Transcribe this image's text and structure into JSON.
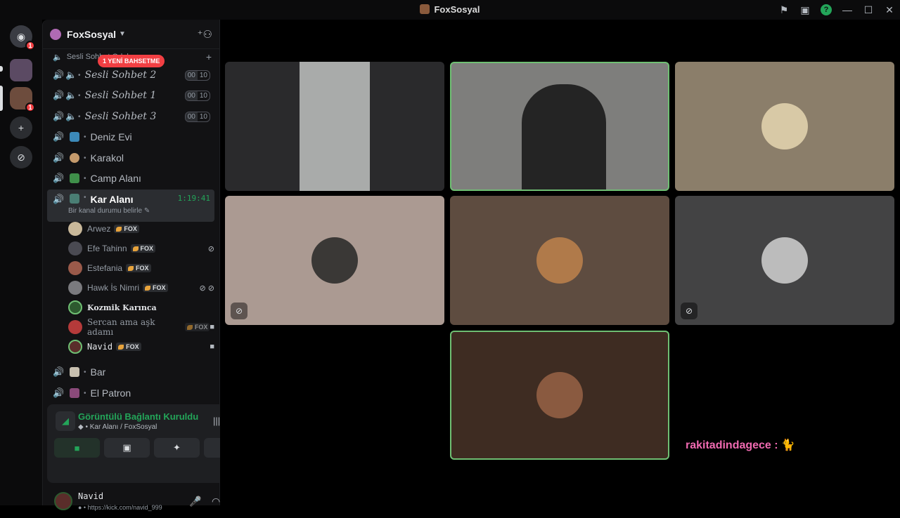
{
  "window": {
    "title": "FoxSosyal"
  },
  "rail": {
    "home_badge": "1",
    "server_badge": "1"
  },
  "server": {
    "name": "FoxSosyal"
  },
  "mention_pill": "1 YENİ BAHSETME",
  "category": {
    "label": "Sesli Sohbet Odaları"
  },
  "channels": [
    {
      "label": "Sesli Sohbet 2",
      "a": "00",
      "b": "10"
    },
    {
      "label": "Sesli Sohbet 1",
      "a": "00",
      "b": "10"
    },
    {
      "label": "Sesli Sohbet 3",
      "a": "00",
      "b": "10"
    },
    {
      "label": "Deniz Evi"
    },
    {
      "label": "Karakol"
    },
    {
      "label": "Camp Alanı"
    },
    {
      "label": "Kar Alanı",
      "timer": "1:19:41",
      "status": "Bir kanal durumu belirle"
    },
    {
      "label": "Bar"
    },
    {
      "label": "El Patron"
    }
  ],
  "members": [
    {
      "name": "Arwez",
      "tag": "FOX"
    },
    {
      "name": "Efe Tahinn",
      "tag": "FOX"
    },
    {
      "name": "Estefania",
      "tag": "FOX"
    },
    {
      "name": "Hawk İs Nimri",
      "tag": "FOX"
    },
    {
      "name": "Kozmik Karınca"
    },
    {
      "name": "Sercan ama aşk adamı",
      "tag": "FOX"
    },
    {
      "name": "Navid",
      "tag": "FOX"
    }
  ],
  "voice": {
    "title": "Görüntülü Bağlantı Kuruldu",
    "subtitle": "Kar Alanı / FoxSosyal"
  },
  "user": {
    "name": "Navid",
    "status": "https://kick.com/navid_999"
  },
  "chat": {
    "user": "rakitadindagece :",
    "message": "🐈"
  },
  "colors": {
    "accent_green": "#23a559",
    "mention_red": "#f23f43",
    "chat_pink": "#f06ab1"
  }
}
